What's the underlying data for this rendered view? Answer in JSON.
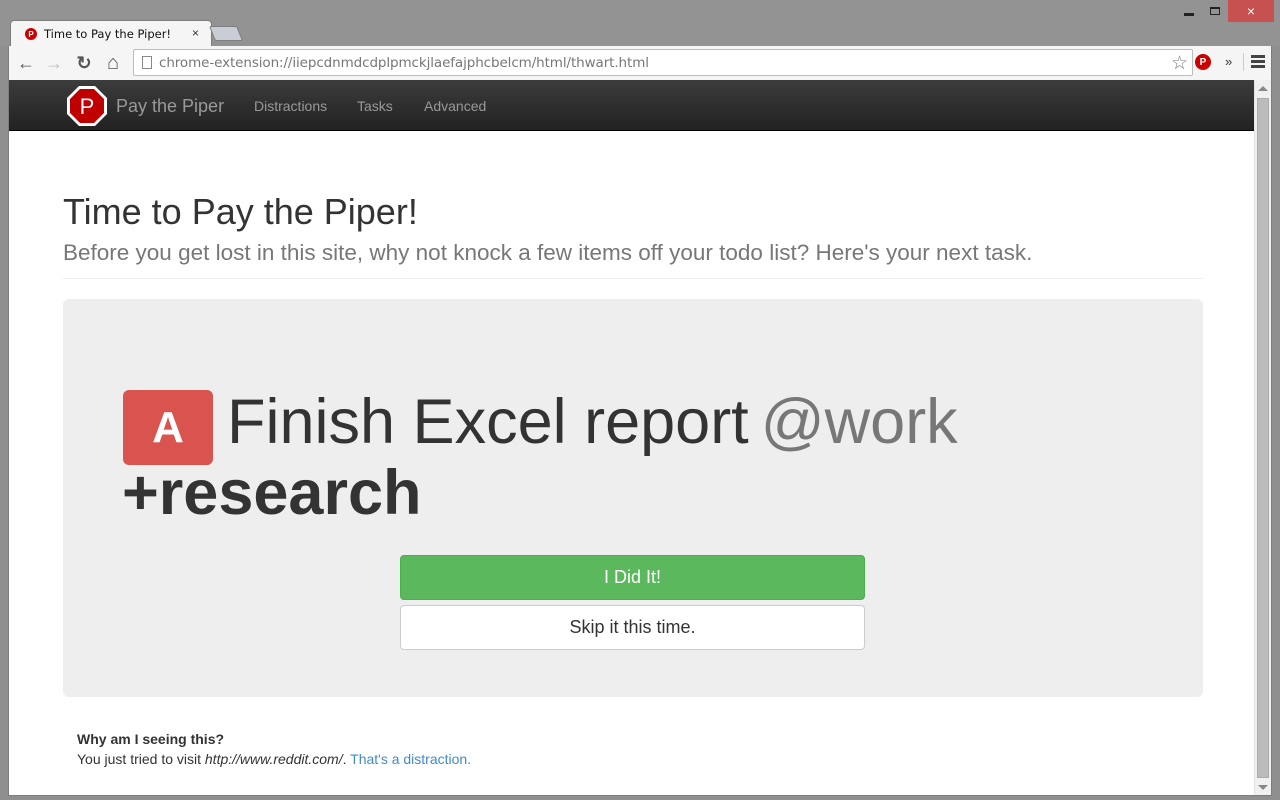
{
  "window": {
    "tab_title": "Time to Pay the Piper!",
    "tab_favicon_letter": "P",
    "tab_close": "×",
    "controls": {
      "minimize": "minimize",
      "maximize": "maximize",
      "close": "×"
    }
  },
  "toolbar": {
    "back_icon": "←",
    "forward_icon": "→",
    "reload_icon": "↻",
    "home_icon": "⌂",
    "url": "chrome-extension://iiepcdnmdcdplpmckjlaefajphcbelcm/html/thwart.html",
    "star_icon": "☆",
    "extension_letter": "P",
    "overflow_icon": "»"
  },
  "navbar": {
    "brand": "Pay the Piper",
    "logo_letter": "P",
    "links": [
      {
        "label": "Distractions"
      },
      {
        "label": "Tasks"
      },
      {
        "label": "Advanced"
      }
    ]
  },
  "page": {
    "title": "Time to Pay the Piper!",
    "subtitle": "Before you get lost in this site, why not knock a few items off your todo list? Here's your next task."
  },
  "task": {
    "priority": "A",
    "text": "Finish Excel report",
    "context": "@work",
    "project": "+research",
    "done_label": "I Did It!",
    "skip_label": "Skip it this time."
  },
  "why": {
    "heading": "Why am I seeing this?",
    "prefix": "You just tried to visit ",
    "visited_url": "http://www.reddit.com/",
    "suffix": ". ",
    "link_label": "That's a distraction."
  },
  "colors": {
    "priority_badge": "#d9534f",
    "done_button": "#5cb85c",
    "link": "#428bca",
    "navbar": "#222222",
    "brand_red": "#cc0000"
  }
}
